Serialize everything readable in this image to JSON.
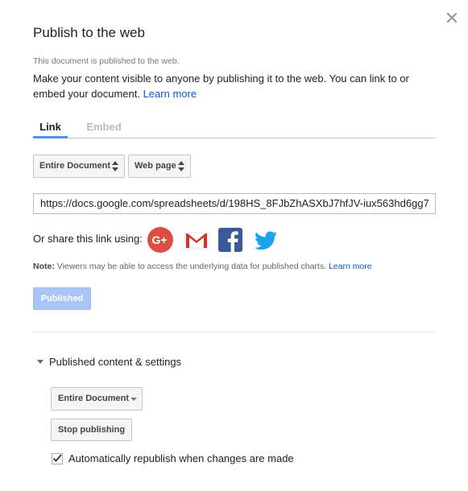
{
  "dialog": {
    "title": "Publish to the web",
    "status": "This document is published to the web.",
    "intro_text": "Make your content visible to anyone by publishing it to the web. You can link to or embed your document. ",
    "learn_more": "Learn more"
  },
  "tabs": [
    {
      "label": "Link",
      "active": true
    },
    {
      "label": "Embed",
      "active": false
    }
  ],
  "selects": {
    "scope": "Entire Document",
    "format": "Web page"
  },
  "url": {
    "value": "https://docs.google.com/spreadsheets/d/198HS_8FJbZhASXbJ7hfJV-iux563hd6gg7"
  },
  "share": {
    "label": "Or share this link using:",
    "icons": [
      "google-plus-icon",
      "gmail-icon",
      "facebook-icon",
      "twitter-icon"
    ]
  },
  "note": {
    "prefix": "Note:",
    "text": " Viewers may be able to access the underlying data for published charts. ",
    "link": "Learn more"
  },
  "publish_button": "Published",
  "settings": {
    "header": "Published content & settings",
    "dropdown": "Entire Document",
    "stop_button": "Stop publishing",
    "auto_republish_label": "Automatically republish when changes are made",
    "auto_republish_checked": true
  },
  "colors": {
    "accent": "#4d90fe",
    "link": "#1155cc",
    "published_btn": "#a7c6f7",
    "gplus": "#dc4e41",
    "gmail_red": "#d93025",
    "facebook": "#3b5998",
    "twitter": "#1da1f2"
  }
}
